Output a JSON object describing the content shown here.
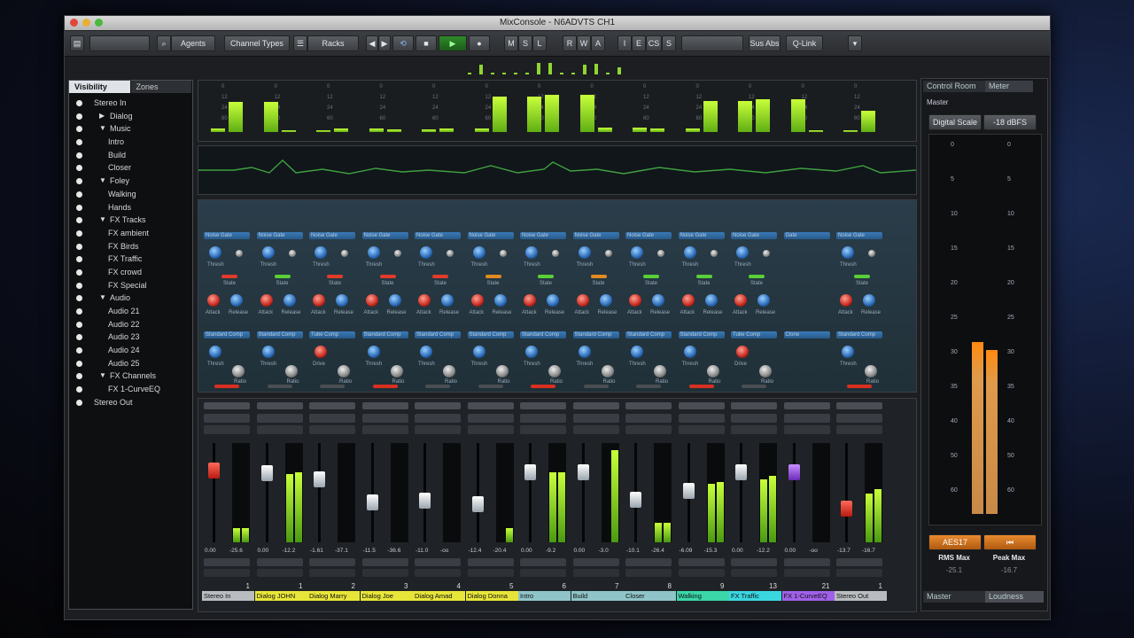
{
  "window": {
    "title": "MixConsole - N6ADVTS CH1"
  },
  "toolbar": {
    "items": [
      {
        "label": "Agents"
      },
      {
        "label": "Channel Types"
      },
      {
        "label": "Racks"
      },
      {
        "label": "M"
      },
      {
        "label": "S"
      },
      {
        "label": "L"
      },
      {
        "label": "R"
      },
      {
        "label": "W"
      },
      {
        "label": "A"
      },
      {
        "label": "I"
      },
      {
        "label": "E"
      },
      {
        "label": "CS"
      },
      {
        "label": "S"
      },
      {
        "label": "Sus Abs"
      },
      {
        "label": "Q-Link"
      }
    ]
  },
  "sidebar": {
    "tabs": [
      "Visibility",
      "Zones"
    ],
    "items": [
      {
        "label": "Stereo In",
        "depth": 0,
        "arrow": ""
      },
      {
        "label": "Dialog",
        "depth": 1,
        "arrow": "right"
      },
      {
        "label": "Music",
        "depth": 1,
        "arrow": "down"
      },
      {
        "label": "Intro",
        "depth": 2,
        "arrow": ""
      },
      {
        "label": "Build",
        "depth": 2,
        "arrow": ""
      },
      {
        "label": "Closer",
        "depth": 2,
        "arrow": ""
      },
      {
        "label": "Foley",
        "depth": 1,
        "arrow": "down"
      },
      {
        "label": "Walking",
        "depth": 2,
        "arrow": ""
      },
      {
        "label": "Hands",
        "depth": 2,
        "arrow": ""
      },
      {
        "label": "FX Tracks",
        "depth": 1,
        "arrow": "down"
      },
      {
        "label": "FX ambient",
        "depth": 2,
        "arrow": ""
      },
      {
        "label": "FX Birds",
        "depth": 2,
        "arrow": ""
      },
      {
        "label": "FX Traffic",
        "depth": 2,
        "arrow": ""
      },
      {
        "label": "FX crowd",
        "depth": 2,
        "arrow": ""
      },
      {
        "label": "FX Special",
        "depth": 2,
        "arrow": ""
      },
      {
        "label": "Audio",
        "depth": 1,
        "arrow": "down"
      },
      {
        "label": "Audio 21",
        "depth": 2,
        "arrow": ""
      },
      {
        "label": "Audio 22",
        "depth": 2,
        "arrow": ""
      },
      {
        "label": "Audio 23",
        "depth": 2,
        "arrow": ""
      },
      {
        "label": "Audio 24",
        "depth": 2,
        "arrow": ""
      },
      {
        "label": "Audio 25",
        "depth": 2,
        "arrow": ""
      },
      {
        "label": "FX Channels",
        "depth": 1,
        "arrow": "down"
      },
      {
        "label": "FX 1-CurveEQ",
        "depth": 2,
        "arrow": ""
      },
      {
        "label": "Stereo Out",
        "depth": 0,
        "arrow": ""
      }
    ]
  },
  "meters_top": {
    "scale": [
      "0",
      "12",
      "24",
      "60"
    ],
    "levels": [
      0.1,
      0.78,
      0.05,
      0.08,
      0.06,
      0.08,
      0.9,
      0.95,
      0.12,
      0.08,
      0.8,
      0.85,
      0.05,
      0.55
    ]
  },
  "strips": {
    "labels": {
      "thresh": "Thresh",
      "state": "State",
      "attack": "Attack",
      "release": "Release",
      "ratio": "Ratio",
      "drive": "Drive"
    },
    "channels": [
      {
        "name": "Stereo In",
        "num": "1",
        "color": "#b8bcc0",
        "fader_color": "red",
        "fader": 0.78,
        "meter": [
          0.15,
          0.15
        ],
        "vol": "0.00",
        "peak": "-25.6",
        "insert1": "Noise Gate",
        "insert2": "Standard Comp",
        "led": "#e23b2a",
        "knob": "blue"
      },
      {
        "name": "Dialog JOHN",
        "num": "1",
        "color": "#e8e53a",
        "fader_color": "white",
        "fader": 0.75,
        "meter": [
          0.7,
          0.72
        ],
        "vol": "0.00",
        "peak": "-12.2",
        "insert1": "Noise Gate",
        "insert2": "Standard Comp",
        "led": "#5ad038",
        "knob": "blue"
      },
      {
        "name": "Dialog Marry",
        "num": "2",
        "color": "#e8e53a",
        "fader_color": "white",
        "fader": 0.68,
        "meter": [
          0.0,
          0.0
        ],
        "vol": "-1.61",
        "peak": "-37.1",
        "insert1": "Noise Gate",
        "insert2": "Tube Comp",
        "led": "#e23b2a",
        "knob": "red"
      },
      {
        "name": "Dialog Joe",
        "num": "3",
        "color": "#e8e53a",
        "fader_color": "white",
        "fader": 0.42,
        "meter": [
          0.0,
          0.0
        ],
        "vol": "-11.5",
        "peak": "-36.6",
        "insert1": "Noise Gate",
        "insert2": "Standard Comp",
        "led": "#e23b2a",
        "knob": "blue"
      },
      {
        "name": "Dialog Amad",
        "num": "4",
        "color": "#e8e53a",
        "fader_color": "white",
        "fader": 0.44,
        "meter": [
          0.0,
          0.0
        ],
        "vol": "-11.0",
        "peak": "-oo",
        "insert1": "Noise Gate",
        "insert2": "Standard Comp",
        "led": "#e23b2a",
        "knob": "blue"
      },
      {
        "name": "Dialog Donna",
        "num": "5",
        "color": "#e8e53a",
        "fader_color": "white",
        "fader": 0.4,
        "meter": [
          0.0,
          0.15
        ],
        "vol": "-12.4",
        "peak": "-20.4",
        "insert1": "Noise Gate",
        "insert2": "Standard Comp",
        "led": "#e08a20",
        "knob": "blue"
      },
      {
        "name": "Intro",
        "num": "6",
        "color": "#8fc4c8",
        "fader_color": "white",
        "fader": 0.76,
        "meter": [
          0.72,
          0.72
        ],
        "vol": "0.00",
        "peak": "-9.2",
        "insert1": "Noise Gate",
        "insert2": "Standard Comp",
        "led": "#5ad038",
        "knob": "blue"
      },
      {
        "name": "Build",
        "num": "7",
        "color": "#8fc4c8",
        "fader_color": "white",
        "fader": 0.76,
        "meter": [
          0.0,
          0.95
        ],
        "vol": "0.00",
        "peak": "-3.0",
        "insert1": "Noise Gate",
        "insert2": "Standard Comp",
        "led": "#e08a20",
        "knob": "blue"
      },
      {
        "name": "Closer",
        "num": "8",
        "color": "#8fc4c8",
        "fader_color": "white",
        "fader": 0.45,
        "meter": [
          0.2,
          0.2
        ],
        "vol": "-10.1",
        "peak": "-26.4",
        "insert1": "Noise Gate",
        "insert2": "Standard Comp",
        "led": "#5ad038",
        "knob": "blue"
      },
      {
        "name": "Walking",
        "num": "9",
        "color": "#3ad6a8",
        "fader_color": "white",
        "fader": 0.55,
        "meter": [
          0.6,
          0.62
        ],
        "vol": "-6.09",
        "peak": "-15.3",
        "insert1": "Noise Gate",
        "insert2": "Standard Comp",
        "led": "#5ad038",
        "knob": "blue"
      },
      {
        "name": "FX Traffic",
        "num": "13",
        "color": "#3ad6e0",
        "fader_color": "white",
        "fader": 0.76,
        "meter": [
          0.65,
          0.68
        ],
        "vol": "0.00",
        "peak": "-12.2",
        "insert1": "Noise Gate",
        "insert2": "Tube Comp",
        "led": "#5ad038",
        "knob": "red"
      },
      {
        "name": "FX 1-CurveEQ",
        "num": "21",
        "color": "#a060e8",
        "fader_color": "purple",
        "fader": 0.76,
        "meter": [
          0.0,
          0.0
        ],
        "vol": "0.00",
        "peak": "-oo",
        "insert1": "Gate",
        "insert2": "Clone",
        "led": "",
        "knob": "none"
      },
      {
        "name": "Stereo Out",
        "num": "1",
        "color": "#b8bcc0",
        "fader_color": "red",
        "fader": 0.35,
        "meter": [
          0.5,
          0.55
        ],
        "vol": "-13.7",
        "peak": "-16.7",
        "insert1": "Noise Gate",
        "insert2": "Standard Comp",
        "led": "#5ad038",
        "knob": "blue"
      }
    ]
  },
  "right_panel": {
    "tabs": [
      "Control Room",
      "Meter"
    ],
    "section": "Master",
    "scale_button": "Digital Scale",
    "ref_button": "-18 dBFS",
    "scale": [
      "0",
      "5",
      "10",
      "15",
      "20",
      "25",
      "30",
      "35",
      "40",
      "50",
      "60"
    ],
    "meter": [
      0.44,
      0.42
    ],
    "buttons": [
      "AES17",
      "⏮"
    ],
    "rms_label": "RMS Max",
    "peak_label": "Peak Max",
    "rms_value": "-25.1",
    "peak_value": "-16.7",
    "bottom_tabs": [
      "Master",
      "Loudness"
    ]
  }
}
